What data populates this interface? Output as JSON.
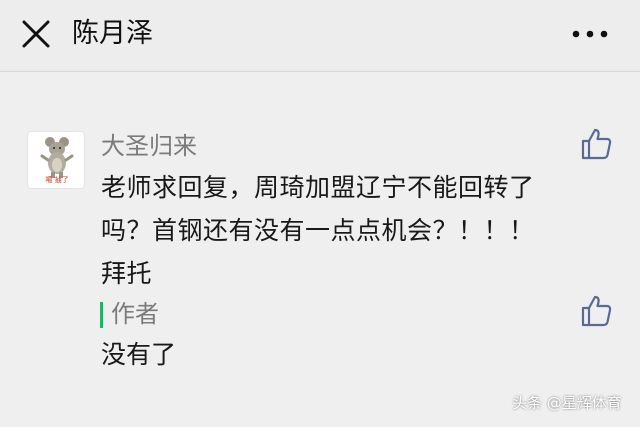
{
  "header": {
    "title": "陈月泽",
    "close_icon": "close-icon",
    "more_icon": "more-horizontal-icon"
  },
  "comment": {
    "avatar_caption": "噶 抽了",
    "nickname": "大圣归来",
    "text_lines": [
      "老师求回复，周琦加盟辽宁不能回转了",
      "吗？首钢还有没有一点点机会？！！！",
      "拜托"
    ],
    "like_icon": "thumbs-up-icon",
    "author_reply": {
      "label": "作者",
      "text": "没有了",
      "like_icon": "thumbs-up-icon"
    }
  },
  "watermark": "头条 @星辉体育",
  "colors": {
    "background": "#efefef",
    "accent_green": "#07c160",
    "icon_blue": "#576b95",
    "nickname_gray": "#7b7b7b"
  }
}
